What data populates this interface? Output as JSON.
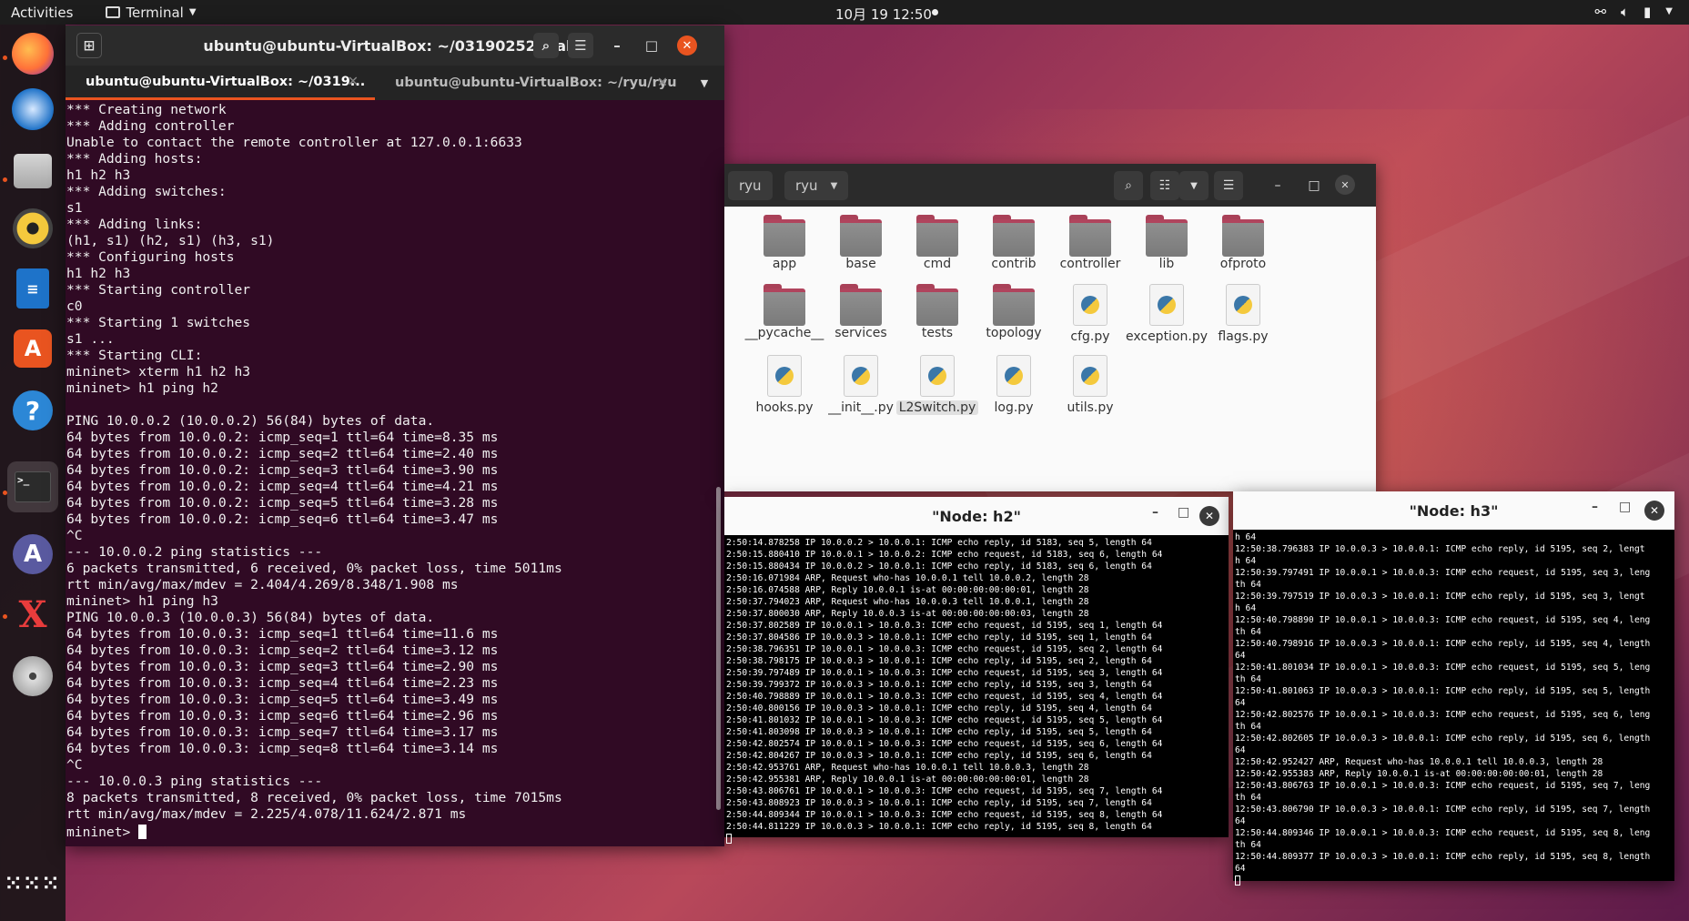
{
  "topbar": {
    "activities": "Activities",
    "app_name": "Terminal",
    "clock": "10月 19  12:50"
  },
  "terminal": {
    "title": "ubuntu@ubuntu-VirtualBox: ~/031902525/lab6",
    "tabs": [
      {
        "label": "ubuntu@ubuntu-VirtualBox: ~/0319..."
      },
      {
        "label": "ubuntu@ubuntu-VirtualBox: ~/ryu/ryu"
      }
    ],
    "lines": [
      "*** Creating network",
      "*** Adding controller",
      "Unable to contact the remote controller at 127.0.0.1:6633",
      "*** Adding hosts:",
      "h1 h2 h3",
      "*** Adding switches:",
      "s1",
      "*** Adding links:",
      "(h1, s1) (h2, s1) (h3, s1)",
      "*** Configuring hosts",
      "h1 h2 h3",
      "*** Starting controller",
      "c0",
      "*** Starting 1 switches",
      "s1 ...",
      "*** Starting CLI:",
      "mininet> xterm h1 h2 h3",
      "mininet> h1 ping h2",
      "",
      "PING 10.0.0.2 (10.0.0.2) 56(84) bytes of data.",
      "64 bytes from 10.0.0.2: icmp_seq=1 ttl=64 time=8.35 ms",
      "64 bytes from 10.0.0.2: icmp_seq=2 ttl=64 time=2.40 ms",
      "64 bytes from 10.0.0.2: icmp_seq=3 ttl=64 time=3.90 ms",
      "64 bytes from 10.0.0.2: icmp_seq=4 ttl=64 time=4.21 ms",
      "64 bytes from 10.0.0.2: icmp_seq=5 ttl=64 time=3.28 ms",
      "64 bytes from 10.0.0.2: icmp_seq=6 ttl=64 time=3.47 ms",
      "^C",
      "--- 10.0.0.2 ping statistics ---",
      "6 packets transmitted, 6 received, 0% packet loss, time 5011ms",
      "rtt min/avg/max/mdev = 2.404/4.269/8.348/1.908 ms",
      "mininet> h1 ping h3",
      "PING 10.0.0.3 (10.0.0.3) 56(84) bytes of data.",
      "64 bytes from 10.0.0.3: icmp_seq=1 ttl=64 time=11.6 ms",
      "64 bytes from 10.0.0.3: icmp_seq=2 ttl=64 time=3.12 ms",
      "64 bytes from 10.0.0.3: icmp_seq=3 ttl=64 time=2.90 ms",
      "64 bytes from 10.0.0.3: icmp_seq=4 ttl=64 time=2.23 ms",
      "64 bytes from 10.0.0.3: icmp_seq=5 ttl=64 time=3.49 ms",
      "64 bytes from 10.0.0.3: icmp_seq=6 ttl=64 time=2.96 ms",
      "64 bytes from 10.0.0.3: icmp_seq=7 ttl=64 time=3.17 ms",
      "64 bytes from 10.0.0.3: icmp_seq=8 ttl=64 time=3.14 ms",
      "^C",
      "--- 10.0.0.3 ping statistics ---",
      "8 packets transmitted, 8 received, 0% packet loss, time 7015ms",
      "rtt min/avg/max/mdev = 2.225/4.078/11.624/2.871 ms"
    ],
    "prompt": "mininet> "
  },
  "files": {
    "crumbs": [
      "ryu",
      "ryu"
    ],
    "items": [
      {
        "name": "app",
        "kind": "folder"
      },
      {
        "name": "base",
        "kind": "folder"
      },
      {
        "name": "cmd",
        "kind": "folder"
      },
      {
        "name": "contrib",
        "kind": "folder"
      },
      {
        "name": "controller",
        "kind": "folder"
      },
      {
        "name": "lib",
        "kind": "folder"
      },
      {
        "name": "ofproto",
        "kind": "folder"
      },
      {
        "name": "__pycache__",
        "kind": "folder"
      },
      {
        "name": "services",
        "kind": "folder"
      },
      {
        "name": "tests",
        "kind": "folder"
      },
      {
        "name": "topology",
        "kind": "folder"
      },
      {
        "name": "cfg.py",
        "kind": "python"
      },
      {
        "name": "exception.py",
        "kind": "python"
      },
      {
        "name": "flags.py",
        "kind": "python"
      },
      {
        "name": "hooks.py",
        "kind": "python"
      },
      {
        "name": "__init__.py",
        "kind": "python"
      },
      {
        "name": "L2Switch.py",
        "kind": "python",
        "selected": true
      },
      {
        "name": "log.py",
        "kind": "python"
      },
      {
        "name": "utils.py",
        "kind": "python"
      }
    ]
  },
  "xterm_h2": {
    "title": "\"Node: h2\"",
    "lines": [
      "2:50:14.878258 IP 10.0.0.2 > 10.0.0.1: ICMP echo reply, id 5183, seq 5, length 64",
      "2:50:15.880410 IP 10.0.0.1 > 10.0.0.2: ICMP echo request, id 5183, seq 6, length 64",
      "2:50:15.880434 IP 10.0.0.2 > 10.0.0.1: ICMP echo reply, id 5183, seq 6, length 64",
      "2:50:16.071984 ARP, Request who-has 10.0.0.1 tell 10.0.0.2, length 28",
      "2:50:16.074588 ARP, Reply 10.0.0.1 is-at 00:00:00:00:00:01, length 28",
      "2:50:37.794023 ARP, Request who-has 10.0.0.3 tell 10.0.0.1, length 28",
      "2:50:37.800030 ARP, Reply 10.0.0.3 is-at 00:00:00:00:00:03, length 28",
      "2:50:37.802589 IP 10.0.0.1 > 10.0.0.3: ICMP echo request, id 5195, seq 1, length 64",
      "2:50:37.804586 IP 10.0.0.3 > 10.0.0.1: ICMP echo reply, id 5195, seq 1, length 64",
      "2:50:38.796351 IP 10.0.0.1 > 10.0.0.3: ICMP echo request, id 5195, seq 2, length 64",
      "2:50:38.798175 IP 10.0.0.3 > 10.0.0.1: ICMP echo reply, id 5195, seq 2, length 64",
      "2:50:39.797489 IP 10.0.0.1 > 10.0.0.3: ICMP echo request, id 5195, seq 3, length 64",
      "2:50:39.799372 IP 10.0.0.3 > 10.0.0.1: ICMP echo reply, id 5195, seq 3, length 64",
      "2:50:40.798889 IP 10.0.0.1 > 10.0.0.3: ICMP echo request, id 5195, seq 4, length 64",
      "2:50:40.800156 IP 10.0.0.3 > 10.0.0.1: ICMP echo reply, id 5195, seq 4, length 64",
      "2:50:41.801032 IP 10.0.0.1 > 10.0.0.3: ICMP echo request, id 5195, seq 5, length 64",
      "2:50:41.803098 IP 10.0.0.3 > 10.0.0.1: ICMP echo reply, id 5195, seq 5, length 64",
      "2:50:42.802574 IP 10.0.0.1 > 10.0.0.3: ICMP echo request, id 5195, seq 6, length 64",
      "2:50:42.804267 IP 10.0.0.3 > 10.0.0.1: ICMP echo reply, id 5195, seq 6, length 64",
      "2:50:42.953761 ARP, Request who-has 10.0.0.1 tell 10.0.0.3, length 28",
      "2:50:42.955381 ARP, Reply 10.0.0.1 is-at 00:00:00:00:00:01, length 28",
      "2:50:43.806761 IP 10.0.0.1 > 10.0.0.3: ICMP echo request, id 5195, seq 7, length 64",
      "2:50:43.808923 IP 10.0.0.3 > 10.0.0.1: ICMP echo reply, id 5195, seq 7, length 64",
      "2:50:44.809344 IP 10.0.0.1 > 10.0.0.3: ICMP echo request, id 5195, seq 8, length 64",
      "2:50:44.811229 IP 10.0.0.3 > 10.0.0.1: ICMP echo reply, id 5195, seq 8, length 64"
    ]
  },
  "xterm_h3": {
    "title": "\"Node: h3\"",
    "lines": [
      "h 64",
      "12:50:38.796383 IP 10.0.0.3 > 10.0.0.1: ICMP echo reply, id 5195, seq 2, lengt",
      "h 64",
      "12:50:39.797491 IP 10.0.0.1 > 10.0.0.3: ICMP echo request, id 5195, seq 3, leng",
      "th 64",
      "12:50:39.797519 IP 10.0.0.3 > 10.0.0.1: ICMP echo reply, id 5195, seq 3, lengt",
      "h 64",
      "12:50:40.798890 IP 10.0.0.1 > 10.0.0.3: ICMP echo request, id 5195, seq 4, leng",
      "th 64",
      "12:50:40.798916 IP 10.0.0.3 > 10.0.0.1: ICMP echo reply, id 5195, seq 4, length",
      "64",
      "12:50:41.801034 IP 10.0.0.1 > 10.0.0.3: ICMP echo request, id 5195, seq 5, leng",
      "th 64",
      "12:50:41.801063 IP 10.0.0.3 > 10.0.0.1: ICMP echo reply, id 5195, seq 5, length",
      "64",
      "12:50:42.802576 IP 10.0.0.1 > 10.0.0.3: ICMP echo request, id 5195, seq 6, leng",
      "th 64",
      "12:50:42.802605 IP 10.0.0.3 > 10.0.0.1: ICMP echo reply, id 5195, seq 6, length",
      "64",
      "12:50:42.952427 ARP, Request who-has 10.0.0.1 tell 10.0.0.3, length 28",
      "12:50:42.955383 ARP, Reply 10.0.0.1 is-at 00:00:00:00:00:01, length 28",
      "12:50:43.806763 IP 10.0.0.1 > 10.0.0.3: ICMP echo request, id 5195, seq 7, leng",
      "th 64",
      "12:50:43.806790 IP 10.0.0.3 > 10.0.0.1: ICMP echo reply, id 5195, seq 7, length",
      "64",
      "12:50:44.809346 IP 10.0.0.1 > 10.0.0.3: ICMP echo request, id 5195, seq 8, leng",
      "th 64",
      "12:50:44.809377 IP 10.0.0.3 > 10.0.0.1: ICMP echo reply, id 5195, seq 8, length",
      "64"
    ]
  },
  "dock_apps": [
    "firefox-icon",
    "thunderbird-icon",
    "files-icon",
    "rhythmbox-icon",
    "writer-icon",
    "software-icon",
    "help-icon",
    "terminal-icon",
    "ubuntu-software-icon",
    "xterm-icon",
    "dvd-icon",
    "show-apps-icon"
  ]
}
